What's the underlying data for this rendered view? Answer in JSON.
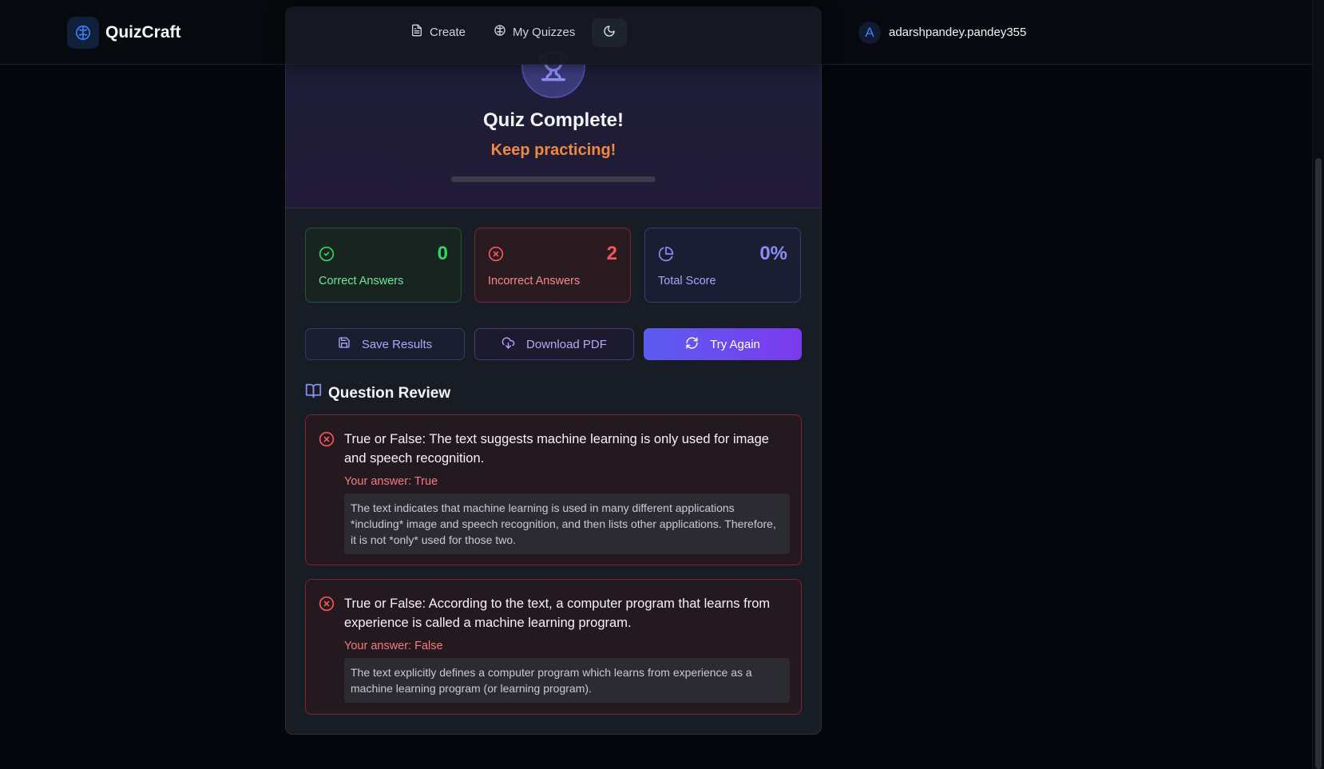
{
  "app": {
    "name": "QuizCraft"
  },
  "nav": {
    "create": "Create",
    "my_quizzes": "My Quizzes",
    "user": {
      "avatar_letter": "A",
      "username": "adarshpandey.pandey355"
    }
  },
  "result": {
    "title": "Quiz Complete!",
    "subtitle": "Keep practicing!",
    "progress_fraction": 0.0
  },
  "stats": {
    "correct": {
      "value": "0",
      "label": "Correct Answers"
    },
    "incorrect": {
      "value": "2",
      "label": "Incorrect Answers"
    },
    "score": {
      "value": "0%",
      "label": "Total Score"
    }
  },
  "actions": {
    "save": "Save Results",
    "download": "Download PDF",
    "retry": "Try Again"
  },
  "review": {
    "heading": "Question Review",
    "questions": [
      {
        "text": "True or False: The text suggests machine learning is only used for image and speech recognition.",
        "answer": "Your answer: True",
        "explanation": "The text indicates that machine learning is used in many different applications *including* image and speech recognition, and then lists other applications. Therefore, it is not *only* used for those two."
      },
      {
        "text": "True or False: According to the text, a computer program that learns from experience is called a machine learning program.",
        "answer": "Your answer: False",
        "explanation": "The text explicitly defines a computer program which learns from experience as a machine learning program (or learning program)."
      }
    ]
  },
  "colors": {
    "accent": "#6366f1",
    "correct": "#34d36b",
    "incorrect": "#f2565a",
    "warning": "#f0893f"
  },
  "icons": {
    "logo": "brain-icon",
    "create": "file-text-icon",
    "my_quizzes": "brain-icon",
    "theme": "moon-icon",
    "trophy": "trophy-icon",
    "correct": "check-circle-icon",
    "incorrect": "x-circle-icon",
    "score": "pie-chart-icon",
    "save": "save-icon",
    "download": "cloud-download-icon",
    "retry": "refresh-icon",
    "review": "book-open-icon"
  }
}
